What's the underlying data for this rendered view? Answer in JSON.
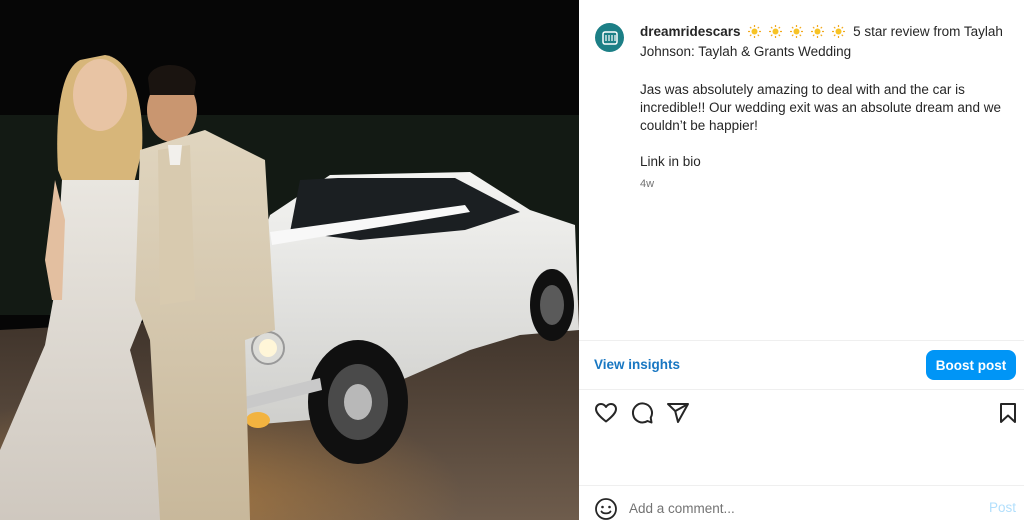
{
  "post": {
    "username": "dreamridescars",
    "sun_icon": "sun-emoji",
    "sun_count": 5,
    "headline": "5 star review from Taylah Johnson: Taylah & Grants Wedding",
    "body": "Jas was absolutely amazing to deal with and the car is incredible!! Our wedding exit was an absolute dream and we couldn’t be happier!",
    "link_text": "Link in bio",
    "age": "4w"
  },
  "insights": {
    "view_label": "View insights",
    "boost_label": "Boost post"
  },
  "actions": {
    "like_icon": "heart-icon",
    "comment_icon": "comment-icon",
    "share_icon": "send-icon",
    "save_icon": "bookmark-icon"
  },
  "comment": {
    "placeholder": "Add a comment...",
    "post_label": "Post"
  },
  "colors": {
    "accent": "#0095f6",
    "link": "#1877c2",
    "avatar": "#1c7f86"
  }
}
